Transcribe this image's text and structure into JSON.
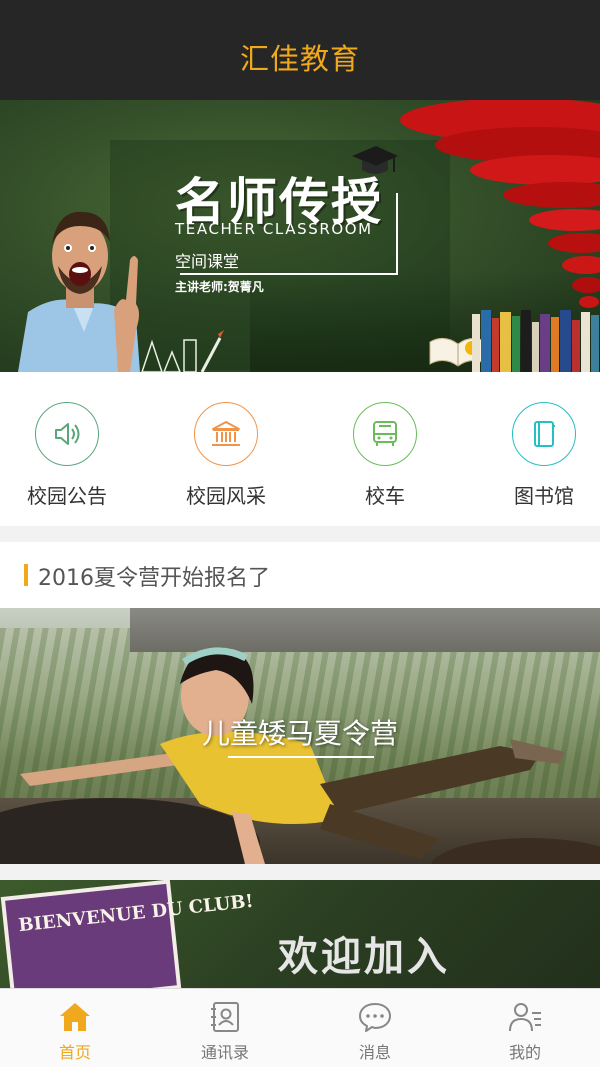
{
  "header": {
    "title": "汇佳教育"
  },
  "banner": {
    "headline": "名师传授",
    "subtitle_en": "TEACHER CLASSROOM",
    "subtitle_cn": "空间课堂",
    "teacher": "主讲老师:贺菁凡"
  },
  "quick_menu": [
    {
      "label": "校园公告",
      "icon": "speaker-icon",
      "color": "#5aa77c"
    },
    {
      "label": "校园风采",
      "icon": "building-icon",
      "color": "#f0944a"
    },
    {
      "label": "校车",
      "icon": "bus-icon",
      "color": "#6cbb5b"
    },
    {
      "label": "图书馆",
      "icon": "book-icon",
      "color": "#27bfc4"
    }
  ],
  "news": {
    "title": "2016夏令营开始报名了"
  },
  "cards": [
    {
      "caption": "儿童矮马夏令营"
    },
    {
      "caption": "欢迎加入",
      "sign": "BIENVENUE DU CLUB!"
    }
  ],
  "tabbar": {
    "items": [
      {
        "label": "首页",
        "icon": "home-icon",
        "active": true
      },
      {
        "label": "通讯录",
        "icon": "contacts-icon",
        "active": false
      },
      {
        "label": "消息",
        "icon": "message-icon",
        "active": false
      },
      {
        "label": "我的",
        "icon": "profile-icon",
        "active": false
      }
    ],
    "active_color": "#f0a81c",
    "inactive_color": "#888888"
  }
}
